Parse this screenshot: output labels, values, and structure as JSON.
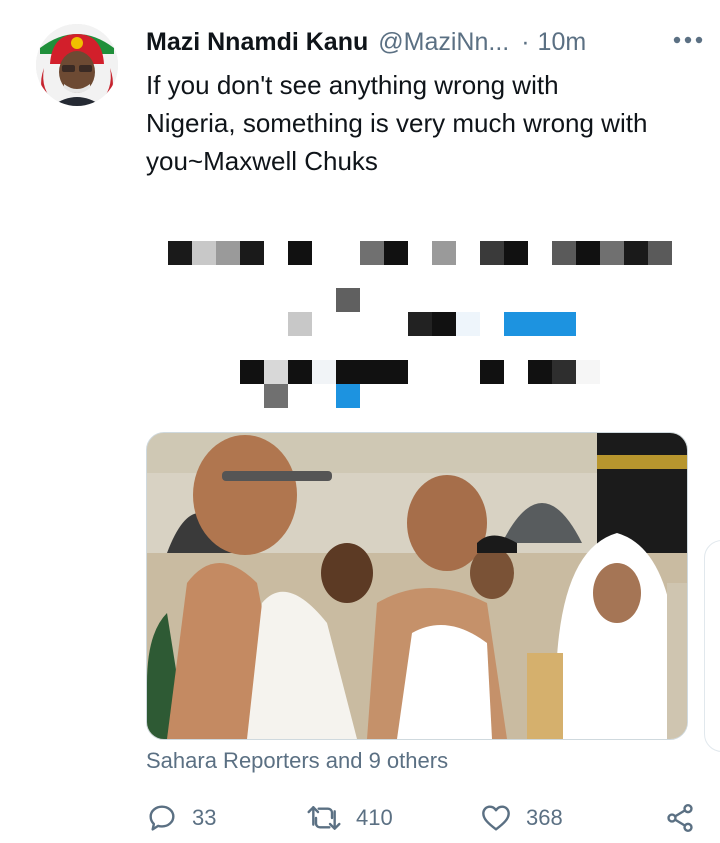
{
  "tweet": {
    "author_name": "Mazi Nnamdi Kanu",
    "author_handle": "@MaziNn...",
    "separator": "·",
    "time": "10m",
    "text": "If you don't see anything wrong with\nNigeria, something is very much wrong with\nyou~Maxwell Chuks",
    "attribution": "Sahara Reporters and 9 others",
    "replies": "33",
    "retweets": "410",
    "likes": "368"
  },
  "icons": {
    "more": "more-dots-icon",
    "reply": "reply-bubble-icon",
    "retweet": "retweet-icon",
    "like": "heart-icon",
    "share": "share-icon"
  },
  "colors": {
    "text": "#0f1419",
    "secondary": "#5b7083",
    "accent": "#1d9bf0"
  }
}
